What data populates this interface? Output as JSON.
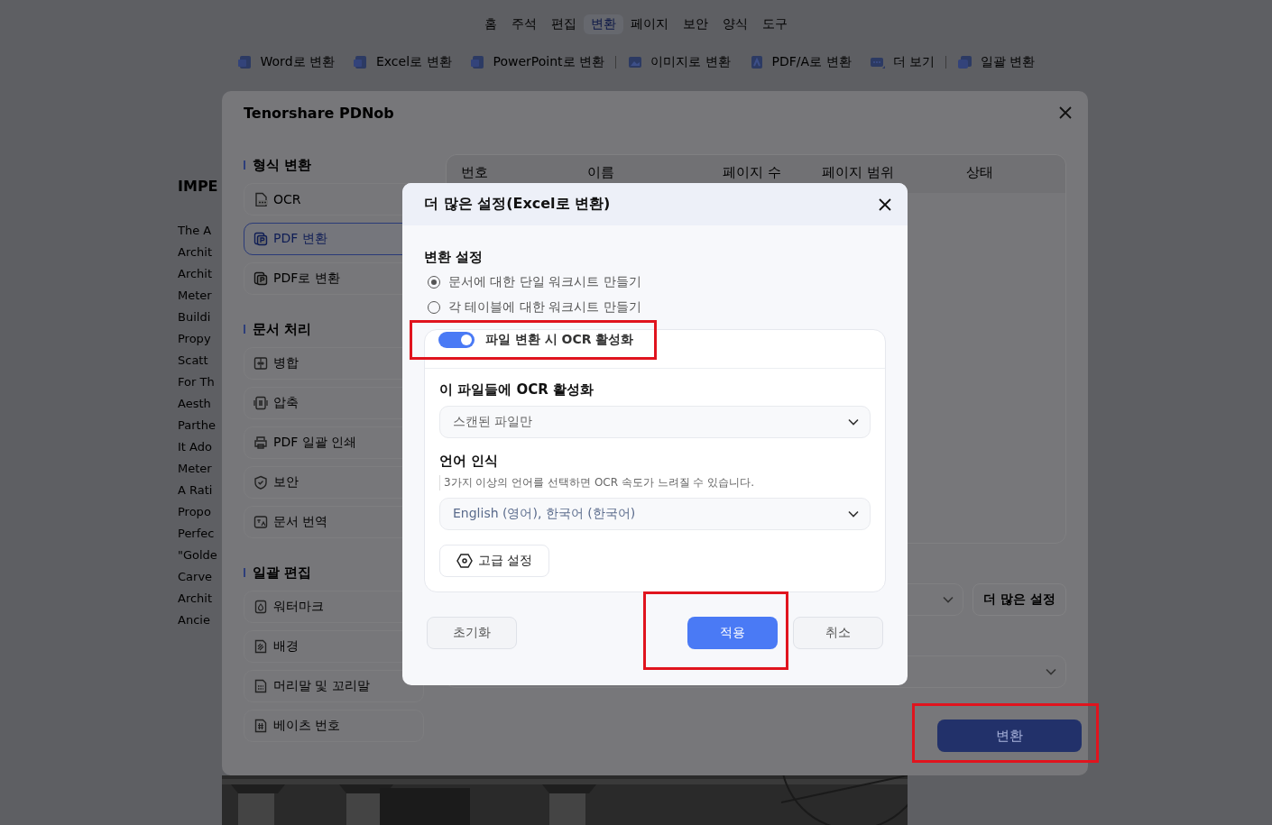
{
  "menu_tabs": [
    {
      "label": "홈",
      "selected": false
    },
    {
      "label": "주석",
      "selected": false
    },
    {
      "label": "편집",
      "selected": false
    },
    {
      "label": "변환",
      "selected": true
    },
    {
      "label": "페이지",
      "selected": false
    },
    {
      "label": "보안",
      "selected": false
    },
    {
      "label": "양식",
      "selected": false
    },
    {
      "label": "도구",
      "selected": false
    }
  ],
  "toolbar": [
    {
      "kind": "button",
      "label": "Word로 변환"
    },
    {
      "kind": "button",
      "label": "Excel로 변환"
    },
    {
      "kind": "button",
      "label": "PowerPoint로 변환"
    },
    {
      "kind": "separator"
    },
    {
      "kind": "button",
      "label": "이미지로 변환"
    },
    {
      "kind": "button",
      "label": "PDF/A로 변환"
    },
    {
      "kind": "button",
      "label": "더 보기"
    },
    {
      "kind": "separator"
    },
    {
      "kind": "button",
      "label": "일괄 변환"
    }
  ],
  "document": {
    "heading": "IMPE",
    "lines": [
      "The A",
      "Archit",
      "Archit",
      "Meter",
      "Buildi",
      "Propy",
      "Scatt",
      "For Th",
      "Aesth",
      "Parthe",
      "It Ado",
      "Meter",
      "A Rati",
      "Propo",
      "Perfec",
      "\"Golde",
      "Carve",
      "Archit",
      "Ancie"
    ]
  },
  "modal": {
    "title": "Tenorshare PDNob",
    "sections": [
      {
        "title": "형식 변환",
        "items": [
          {
            "label": "OCR",
            "selected": false
          },
          {
            "label": "PDF 변환",
            "selected": true
          },
          {
            "label": "PDF로 변환",
            "selected": false
          }
        ]
      },
      {
        "title": "문서 처리",
        "items": [
          {
            "label": "병합",
            "selected": false
          },
          {
            "label": "압축",
            "selected": false
          },
          {
            "label": "PDF 일괄 인쇄",
            "selected": false
          },
          {
            "label": "보안",
            "selected": false
          },
          {
            "label": "문서 번역",
            "selected": false
          }
        ]
      },
      {
        "title": "일괄 편집",
        "items": [
          {
            "label": "워터마크",
            "selected": false
          },
          {
            "label": "배경",
            "selected": false
          },
          {
            "label": "머리말 및 꼬리말",
            "selected": false
          },
          {
            "label": "베이츠 번호",
            "selected": false
          }
        ]
      }
    ],
    "table": {
      "columns": [
        "번호",
        "이름",
        "페이지 수",
        "페이지 범위",
        "상태"
      ]
    },
    "more_settings_button": "더 많은 설정",
    "convert_button": {
      "label": "변환",
      "highlighted": true
    }
  },
  "dialog": {
    "title": "더 많은 설정(Excel로 변환)",
    "section_title": "변환 설정",
    "options": [
      {
        "label": "문서에 대한 단일 워크시트 만들기",
        "selected": true
      },
      {
        "label": "각 테이블에 대한 워크시트 만들기",
        "selected": false
      }
    ],
    "ocr_toggle": {
      "label": "파일 변환 시 OCR 활성화",
      "on": true,
      "highlighted": true
    },
    "ocr_files": {
      "label": "이 파일들에 OCR 활성화",
      "value": "스캔된 파일만"
    },
    "language": {
      "label": "언어 인식",
      "hint": "3가지 이상의 언어를 선택하면 OCR 속도가 느려질 수 있습니다.",
      "value": "English (영어), 한국어 (한국어)"
    },
    "advanced_button": "고급 설정",
    "buttons": [
      {
        "label": "초기화",
        "kind": "secondary",
        "highlighted": false
      },
      {
        "label": "적용",
        "kind": "primary",
        "highlighted": true
      },
      {
        "label": "취소",
        "kind": "secondary",
        "highlighted": false
      }
    ]
  }
}
